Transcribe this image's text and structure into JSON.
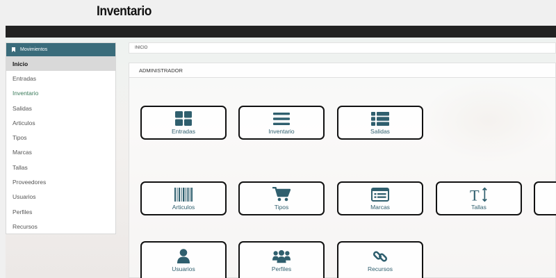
{
  "app": {
    "title": "Inventario"
  },
  "sidebar": {
    "header": "Movimientos",
    "items": [
      {
        "label": "Inicio"
      },
      {
        "label": "Entradas"
      },
      {
        "label": "Inventario"
      },
      {
        "label": "Salidas"
      },
      {
        "label": "Articulos"
      },
      {
        "label": "Tipos"
      },
      {
        "label": "Marcas"
      },
      {
        "label": "Tallas"
      },
      {
        "label": "Proveedores"
      },
      {
        "label": "Usuarios"
      },
      {
        "label": "Perfiles"
      },
      {
        "label": "Recursos"
      }
    ]
  },
  "breadcrumb": {
    "text": "INICIO"
  },
  "panel": {
    "title": "ADMINISTRADOR"
  },
  "tiles": {
    "entradas": {
      "label": "Entradas",
      "icon": "grid-icon"
    },
    "inventario": {
      "label": "Inventario",
      "icon": "bars-icon"
    },
    "salidas": {
      "label": "Salidas",
      "icon": "list-icon"
    },
    "articulos": {
      "label": "Articulos",
      "icon": "barcode-icon"
    },
    "tipos": {
      "label": "Tipos",
      "icon": "cart-icon"
    },
    "marcas": {
      "label": "Marcas",
      "icon": "window-list-icon"
    },
    "tallas": {
      "label": "Tallas",
      "icon": "text-height-icon"
    },
    "usuarios": {
      "label": "Usuarios",
      "icon": "user-icon"
    },
    "perfiles": {
      "label": "Perfiles",
      "icon": "users-icon"
    },
    "recursos": {
      "label": "Recursos",
      "icon": "link-icon"
    }
  },
  "colors": {
    "accent": "#3a6c7b",
    "icon": "#2f5f6e",
    "topbar": "#222222"
  }
}
